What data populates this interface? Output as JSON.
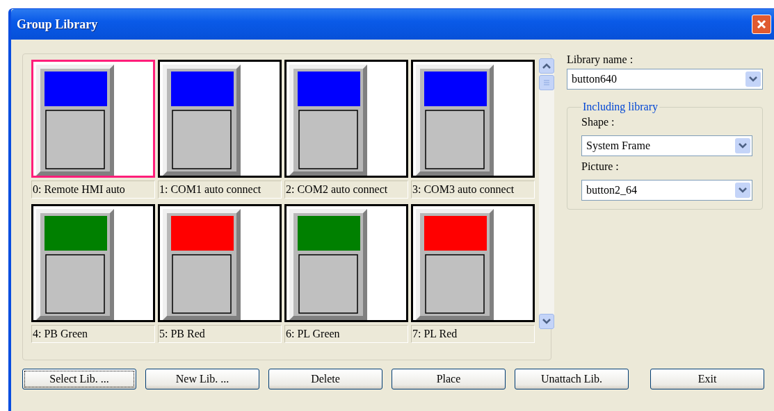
{
  "window": {
    "title": "Group Library"
  },
  "library": {
    "items": [
      {
        "label": "0: Remote HMI auto",
        "color": "#0000ff",
        "selected": true
      },
      {
        "label": "1: COM1 auto connect",
        "color": "#0000ff",
        "selected": false
      },
      {
        "label": "2: COM2 auto connect",
        "color": "#0000ff",
        "selected": false
      },
      {
        "label": "3: COM3 auto connect",
        "color": "#0000ff",
        "selected": false
      },
      {
        "label": "4: PB Green",
        "color": "#008000",
        "selected": false
      },
      {
        "label": "5: PB Red",
        "color": "#ff0000",
        "selected": false
      },
      {
        "label": "6: PL Green",
        "color": "#008000",
        "selected": false
      },
      {
        "label": "7: PL Red",
        "color": "#ff0000",
        "selected": false
      }
    ]
  },
  "library_name": {
    "label": "Library name :",
    "value": "button640"
  },
  "including_library": {
    "title": "Including library",
    "shape": {
      "label": "Shape :",
      "value": "System Frame"
    },
    "picture": {
      "label": "Picture :",
      "value": "button2_64"
    }
  },
  "buttons": [
    {
      "label": "Select Lib. ...",
      "focused": true
    },
    {
      "label": "New Lib. ...",
      "focused": false
    },
    {
      "label": "Delete",
      "focused": false
    },
    {
      "label": "Place",
      "focused": false
    },
    {
      "label": "Unattach Lib.",
      "focused": false
    },
    {
      "label": "Exit",
      "focused": false
    }
  ]
}
